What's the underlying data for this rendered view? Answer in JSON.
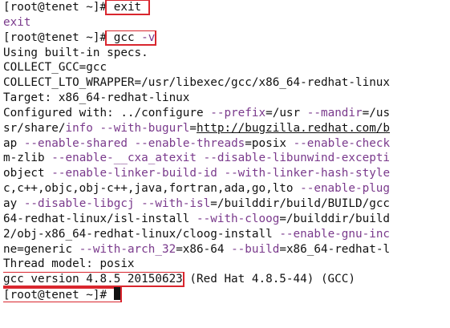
{
  "prompt1": "[root@tenet ~]#",
  "cmd1": "exit",
  "out_exit": "exit",
  "prompt2": "[root@tenet ~]#",
  "cmd2_a": "gcc",
  "cmd2_b": "-v",
  "l_builtin": "Using built-in specs.",
  "l_collect_gcc": "COLLECT_GCC=gcc",
  "l_collect_lto": "COLLECT_LTO_WRAPPER=/usr/libexec/gcc/x86_64-redhat-linux",
  "l_target": "Target: x86_64-redhat-linux",
  "l_conf_a": "Configured with: ../configure ",
  "l_conf_b": "--prefix",
  "l_conf_c": "=/usr ",
  "l_conf_d": "--mandir",
  "l_conf_e": "=/us",
  "l_sr_a": "sr/share/",
  "l_sr_b": "info",
  "l_sr_c": " ",
  "l_sr_d": "--with-bugurl",
  "l_sr_e": "=",
  "l_sr_f": "http://bugzilla.redhat.com/b",
  "l_ap_a": "ap ",
  "l_ap_b": "--enable-shared",
  "l_ap_c": " ",
  "l_ap_d": "--enable-threads",
  "l_ap_e": "=posix ",
  "l_ap_f": "--enable-check",
  "l_mz_a": "m-zlib ",
  "l_mz_b": "--enable-__cxa_atexit",
  "l_mz_c": " ",
  "l_mz_d": "--disable-libunwind-excepti",
  "l_ob_a": "object ",
  "l_ob_b": "--enable-linker-build-id",
  "l_ob_c": " ",
  "l_ob_d": "--with-linker-hash-style",
  "l_c_a": "c,c++,objc,obj-c++,java,fortran,ada,go,lto ",
  "l_c_b": "--enable-plug",
  "l_ay_a": "ay ",
  "l_ay_b": "--disable-libgcj",
  "l_ay_c": " ",
  "l_ay_d": "--with-isl",
  "l_ay_e": "=/builddir/build/BUILD/gcc",
  "l_64_a": "64-redhat-linux/isl-install ",
  "l_64_b": "--with-cloog",
  "l_64_c": "=/builddir/build",
  "l_2_a": "2/obj-x86_64-redhat-linux/cloog-install ",
  "l_2_b": "--enable-gnu-inc",
  "l_ne_a": "ne=generic ",
  "l_ne_b": "--with-arch_32",
  "l_ne_c": "=x86-64 ",
  "l_ne_d": "--build",
  "l_ne_e": "=x86_64-redhat-l",
  "l_thread": "Thread model: posix",
  "l_ver_a": "gcc version 4.8.5 20150623",
  "l_ver_b": " (Red Hat 4.8.5-44) (GCC)",
  "prompt3": "[root@tenet ~]#",
  "colors": {
    "text": "#111111",
    "purple": "#7a3a8c",
    "highlight_box": "#d9262e",
    "background": "#ffffff"
  }
}
